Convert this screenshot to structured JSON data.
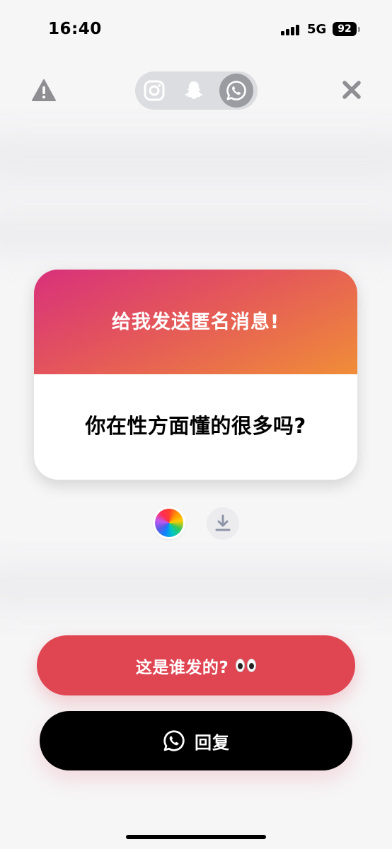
{
  "status_bar": {
    "time": "16:40",
    "network": "5G",
    "battery": "92"
  },
  "top_bar": {
    "report_icon": "warning-triangle-icon",
    "close_icon": "close-icon",
    "platforms": [
      {
        "name": "instagram",
        "icon": "instagram-icon",
        "selected": false
      },
      {
        "name": "snapchat",
        "icon": "snapchat-icon",
        "selected": false
      },
      {
        "name": "whatsapp",
        "icon": "whatsapp-icon",
        "selected": true
      }
    ]
  },
  "card": {
    "title": "给我发送匿名消息!",
    "question": "你在性方面懂的很多吗?",
    "gradient": [
      "#d8317b",
      "#f08d38"
    ]
  },
  "tools": {
    "color_picker_icon": "color-wheel-icon",
    "download_icon": "download-icon"
  },
  "buttons": {
    "who_sent": "这是谁发的?",
    "who_sent_emoji": "eyes-emoji",
    "reply": "回复",
    "who_sent_color": "#e04552",
    "reply_color": "#000000"
  }
}
